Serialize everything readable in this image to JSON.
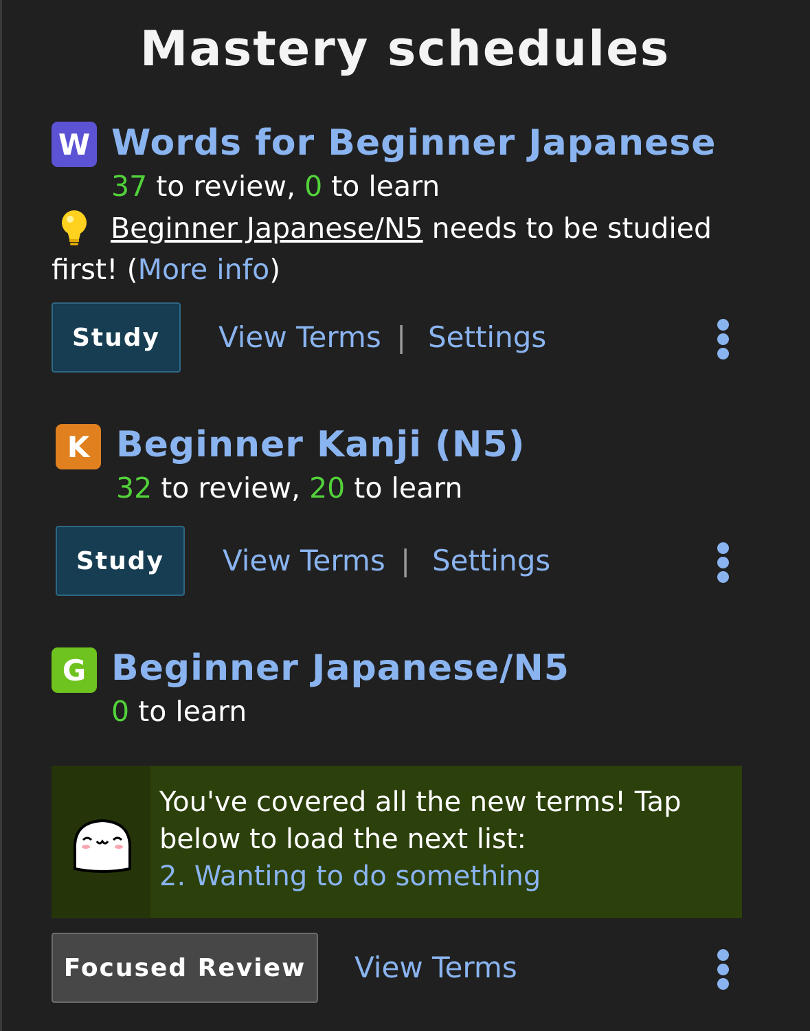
{
  "page_title": "Mastery schedules",
  "schedules": [
    {
      "badge": "W",
      "badge_color": "#5b53d4",
      "title": "Words for Beginner Japanese",
      "review_count": "37",
      "review_label": " to review, ",
      "learn_count": "0",
      "learn_label": " to learn",
      "note": {
        "icon": "lightbulb-icon",
        "prerequisite": "Beginner Japanese/N5",
        "message": " needs to be studied first! (",
        "more_info": "More info",
        "close_paren": ")"
      },
      "primary_button": "Study",
      "view_terms": "View Terms",
      "separator": "|",
      "settings": "Settings"
    },
    {
      "badge": "K",
      "badge_color": "#e0801f",
      "title": "Beginner Kanji (N5)",
      "review_count": "32",
      "review_label": " to review, ",
      "learn_count": "20",
      "learn_label": " to learn",
      "primary_button": "Study",
      "view_terms": "View Terms",
      "separator": "|",
      "settings": "Settings"
    },
    {
      "badge": "G",
      "badge_color": "#6fc31e",
      "title": "Beginner Japanese/N5",
      "learn_count": "0",
      "learn_label": " to learn",
      "banner": {
        "mascot_icon": "white-blob-mascot-icon",
        "message": "You've covered all the new terms! Tap below to load the next list:",
        "next_list": "2. Wanting to do something"
      },
      "primary_button": "Focused Review",
      "view_terms": "View Terms"
    }
  ],
  "colors": {
    "background": "#202020",
    "link": "#8ab4f0",
    "count": "#52d23a",
    "study_button": "#163d52",
    "banner": "#2c400b"
  }
}
